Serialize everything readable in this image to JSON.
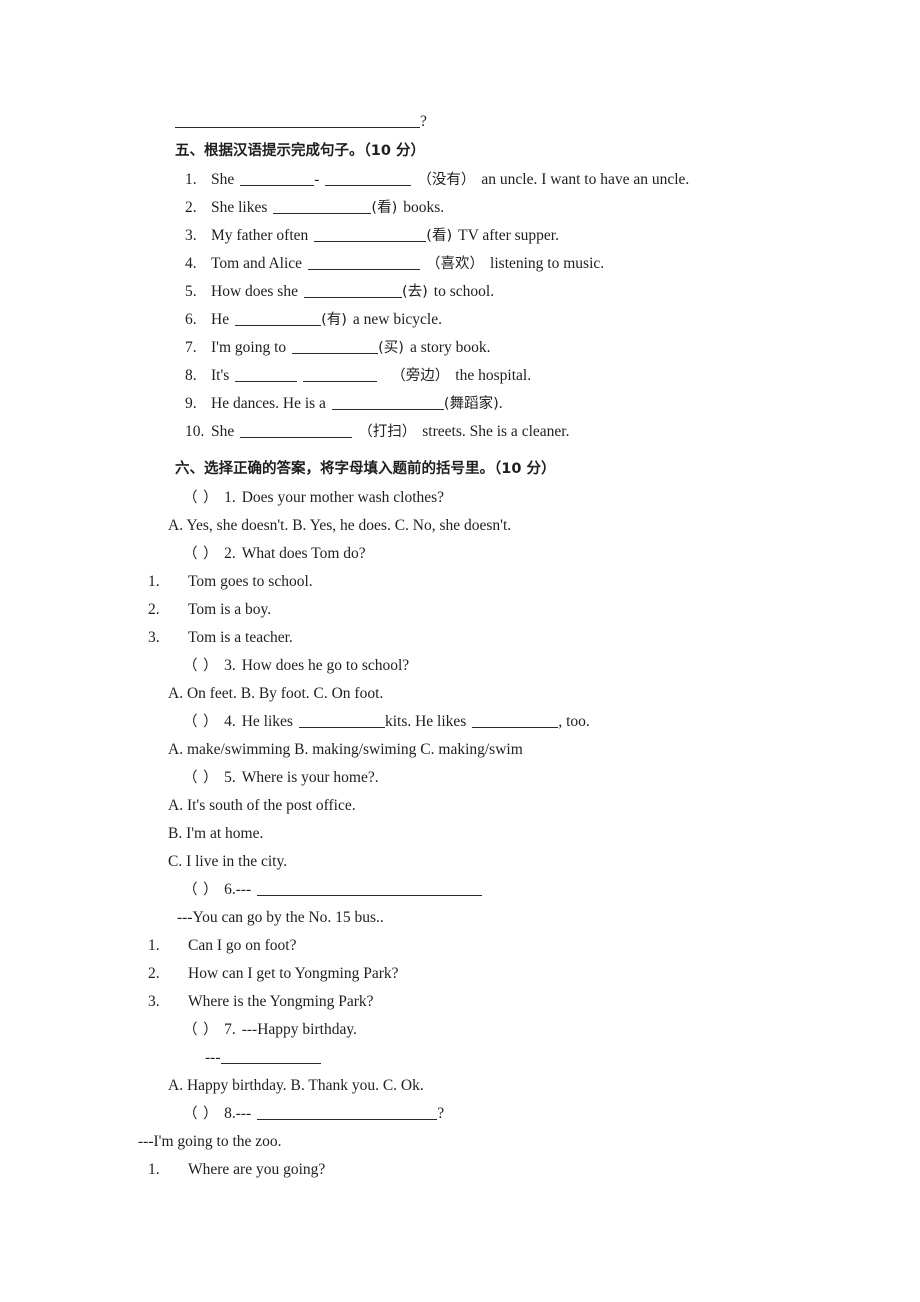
{
  "document": {
    "type": "english-exam-worksheet",
    "language": "en-zh"
  },
  "top_line": {
    "blank": "",
    "trailing": "?"
  },
  "section_five": {
    "heading_cn": "五、根据汉语提示完成句子。",
    "heading_score": "（10 分）",
    "items": [
      {
        "number": "1.",
        "pre": "She",
        "blank1": "",
        "sep": "-",
        "blank2": "",
        "hint": "（没有）",
        "post": "an uncle. I want to have an uncle."
      },
      {
        "number": "2.",
        "pre": "She likes",
        "blank1": "",
        "hint": "(看)",
        "post": "books."
      },
      {
        "number": "3.",
        "pre": "My father often",
        "blank1": "",
        "hint": "(看)",
        "post": "TV after supper."
      },
      {
        "number": "4.",
        "pre": "Tom and Alice",
        "blank1": "",
        "hint": "（喜欢）",
        "post": "listening to music."
      },
      {
        "number": "5.",
        "pre": "How does she",
        "blank1": "",
        "hint": "(去)",
        "post": "to school."
      },
      {
        "number": "6.",
        "pre": "He",
        "blank1": "",
        "hint": "(有)",
        "post": "a new bicycle."
      },
      {
        "number": "7.",
        "pre": "I'm going to",
        "blank1": "",
        "hint": "(买)",
        "post": "a story book."
      },
      {
        "number": "8.",
        "pre": "It's",
        "blank1": "",
        "blank2": "",
        "hint": "（旁边）",
        "post": "the hospital."
      },
      {
        "number": "9.",
        "pre": "He dances. He is a",
        "blank1": "",
        "hint": "(舞蹈家)",
        "post": "."
      },
      {
        "number": "10.",
        "pre": "She",
        "blank1": "",
        "hint": "（打扫）",
        "post": "streets. She is a cleaner."
      }
    ]
  },
  "section_six": {
    "heading_cn": "六、选择正确的答案，将字母填入题前的括号里。",
    "heading_score": "（10 分）",
    "q1": {
      "marker": "（ ）",
      "number": "1.",
      "stem": "Does your mother wash clothes?",
      "options_line": "A. Yes, she doesn't.    B. Yes, he does.   C. No, she doesn't."
    },
    "q2": {
      "marker": "（ ）",
      "number": "2.",
      "stem": "What does Tom do?",
      "sub_options": [
        {
          "num": "1.",
          "text": "Tom goes to school."
        },
        {
          "num": "2.",
          "text": "Tom is a boy."
        },
        {
          "num": "3.",
          "text": "Tom is a teacher."
        }
      ]
    },
    "q3": {
      "marker": "（ ）",
      "number": "3.",
      "stem": "How does he go to school?",
      "options_line": "A. On feet.     B. By foot.     C. On foot."
    },
    "q4": {
      "marker": "（ ）",
      "number": "4.",
      "pre": "He likes",
      "mid": "kits. He likes",
      "post": ", too.",
      "options_line": "A. make/swimming  B. making/swiming   C. making/swim"
    },
    "q5": {
      "marker": "（ ）",
      "number": "5.",
      "stem": "Where is your home?.",
      "options": [
        "A. It's south of the post office.",
        "B. I'm at home.",
        "C. I live in the city."
      ]
    },
    "q6": {
      "marker": "（ ）",
      "number": "6.---",
      "answer_line": "---You can go by the No. 15 bus..",
      "sub_options": [
        {
          "num": "1.",
          "text": "Can I go on foot?"
        },
        {
          "num": "2.",
          "text": "How can I get to Yongming Park?"
        },
        {
          "num": "3.",
          "text": "Where is the Yongming Park?"
        }
      ]
    },
    "q7": {
      "marker": "（ ）",
      "number": "7.",
      "stem": "---Happy birthday.",
      "reply_prefix": "---",
      "options_line": "A. Happy birthday.   B. Thank you.      C. Ok."
    },
    "q8": {
      "marker": "（ ）",
      "number": "8.---",
      "trailing": "?",
      "answer_line": "---I'm going to the zoo.",
      "sub_options": [
        {
          "num": "1.",
          "text": "Where are you going?"
        }
      ]
    }
  }
}
